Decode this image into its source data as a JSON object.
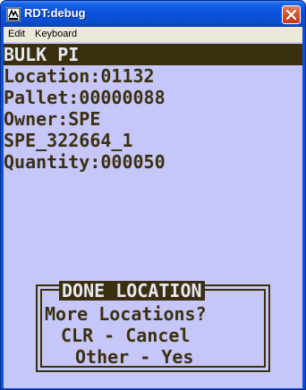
{
  "window": {
    "title": "RDT:debug",
    "colors": {
      "titlebar": "#0a52da",
      "screen_background": "#c6c6f8",
      "screen_text": "#3a3010",
      "inverse_text": "#e8e8f0",
      "close_button": "#d2502e"
    },
    "icons": {
      "app": "rdt-app-icon",
      "close": "close-icon"
    }
  },
  "menu": {
    "edit": "Edit",
    "keyboard": "Keyboard"
  },
  "screen": {
    "header": "BULK PI",
    "lines": [
      "Location:01132",
      "Pallet:00000088",
      "Owner:SPE",
      "SPE_322664_1",
      "Quantity:000050"
    ]
  },
  "dialog": {
    "title": "DONE LOCATION",
    "question": "More Locations?",
    "cancel_option": "CLR - Cancel",
    "yes_option": "Other - Yes"
  }
}
